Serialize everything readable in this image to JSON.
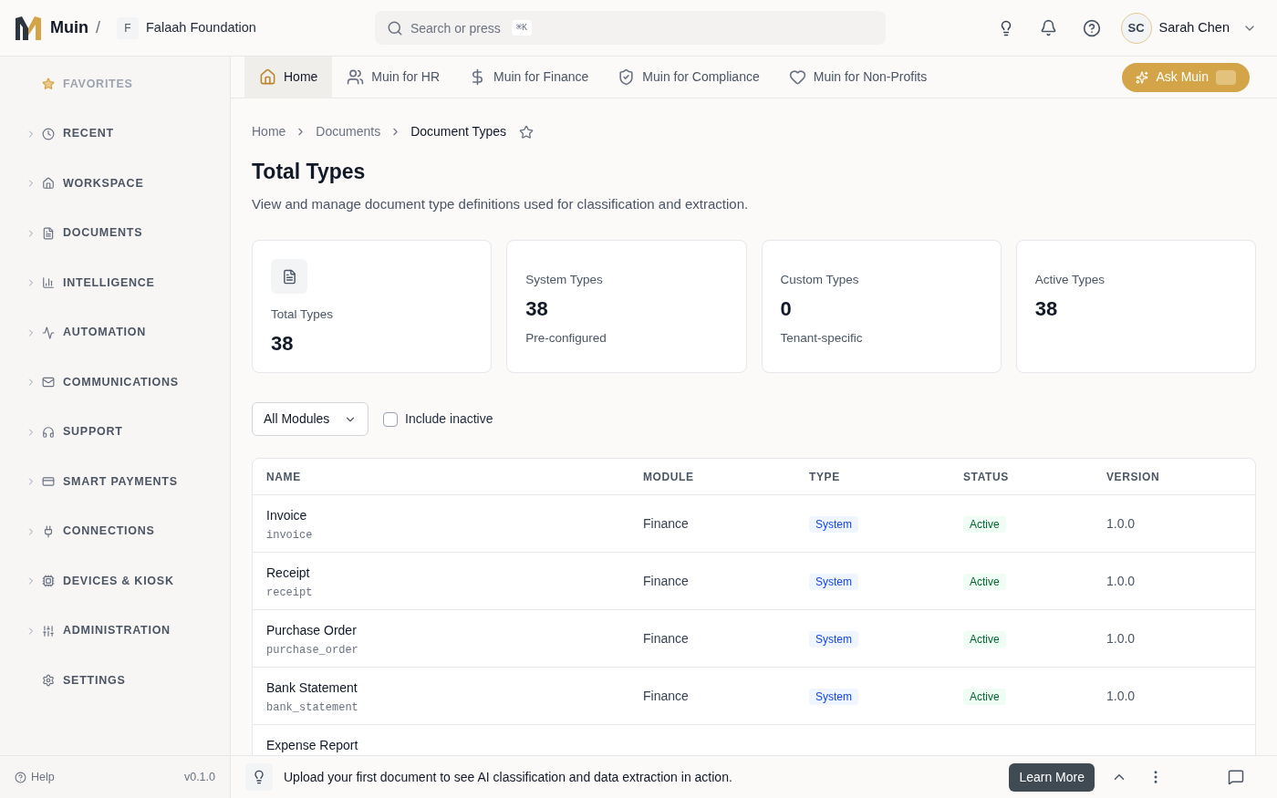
{
  "header": {
    "brand": "Muin",
    "separator": "/",
    "org_initial": "F",
    "org_name": "Falaah Foundation",
    "search": {
      "placeholder": "Search or press",
      "shortcut": "⌘K"
    },
    "user": {
      "initials": "SC",
      "name": "Sarah Chen"
    }
  },
  "sidebar": {
    "items": [
      {
        "kind": "favorites",
        "label": "FAVORITES"
      },
      {
        "kind": "group",
        "label": "RECENT"
      },
      {
        "kind": "group",
        "label": "WORKSPACE"
      },
      {
        "kind": "group",
        "label": "DOCUMENTS"
      },
      {
        "kind": "group",
        "label": "INTELLIGENCE"
      },
      {
        "kind": "group",
        "label": "AUTOMATION"
      },
      {
        "kind": "group",
        "label": "COMMUNICATIONS"
      },
      {
        "kind": "group",
        "label": "SUPPORT"
      },
      {
        "kind": "group",
        "label": "SMART PAYMENTS"
      },
      {
        "kind": "group",
        "label": "CONNECTIONS"
      },
      {
        "kind": "group",
        "label": "DEVICES & KIOSK"
      },
      {
        "kind": "group",
        "label": "ADMINISTRATION"
      },
      {
        "kind": "link",
        "label": "SETTINGS"
      }
    ],
    "help": "Help",
    "version": "v0.1.0"
  },
  "tabs": [
    {
      "label": "Home",
      "selected": true
    },
    {
      "label": "Muin for HR",
      "selected": false
    },
    {
      "label": "Muin for Finance",
      "selected": false
    },
    {
      "label": "Muin for Compliance",
      "selected": false
    },
    {
      "label": "Muin for Non-Profits",
      "selected": false
    }
  ],
  "ask_button": "Ask Muin",
  "breadcrumbs": [
    "Home",
    "Documents",
    "Document Types"
  ],
  "page": {
    "title": "Total Types",
    "description": "View and manage document type definitions used for classification and extraction."
  },
  "stats": [
    {
      "kind": "icon",
      "label": "Total Types",
      "value": "38"
    },
    {
      "kind": "plain",
      "label": "System Types",
      "value": "38",
      "note": "Pre-configured"
    },
    {
      "kind": "plain",
      "label": "Custom Types",
      "value": "0",
      "note": "Tenant-specific"
    },
    {
      "kind": "plain",
      "label": "Active Types",
      "value": "38"
    }
  ],
  "filters": {
    "module": "All Modules",
    "include_inactive": {
      "label": "Include inactive",
      "checked": false
    }
  },
  "table": {
    "columns": [
      "NAME",
      "MODULE",
      "TYPE",
      "STATUS",
      "VERSION"
    ],
    "rows": [
      {
        "name": "Invoice",
        "code": "invoice",
        "module": "Finance",
        "type": "System",
        "status": "Active",
        "version": "1.0.0"
      },
      {
        "name": "Receipt",
        "code": "receipt",
        "module": "Finance",
        "type": "System",
        "status": "Active",
        "version": "1.0.0"
      },
      {
        "name": "Purchase Order",
        "code": "purchase_order",
        "module": "Finance",
        "type": "System",
        "status": "Active",
        "version": "1.0.0"
      },
      {
        "name": "Bank Statement",
        "code": "bank_statement",
        "module": "Finance",
        "type": "System",
        "status": "Active",
        "version": "1.0.0"
      },
      {
        "name": "Expense Report"
      }
    ]
  },
  "banner": {
    "text": "Upload your first document to see AI classification and data extraction in action.",
    "button": "Learn More"
  }
}
